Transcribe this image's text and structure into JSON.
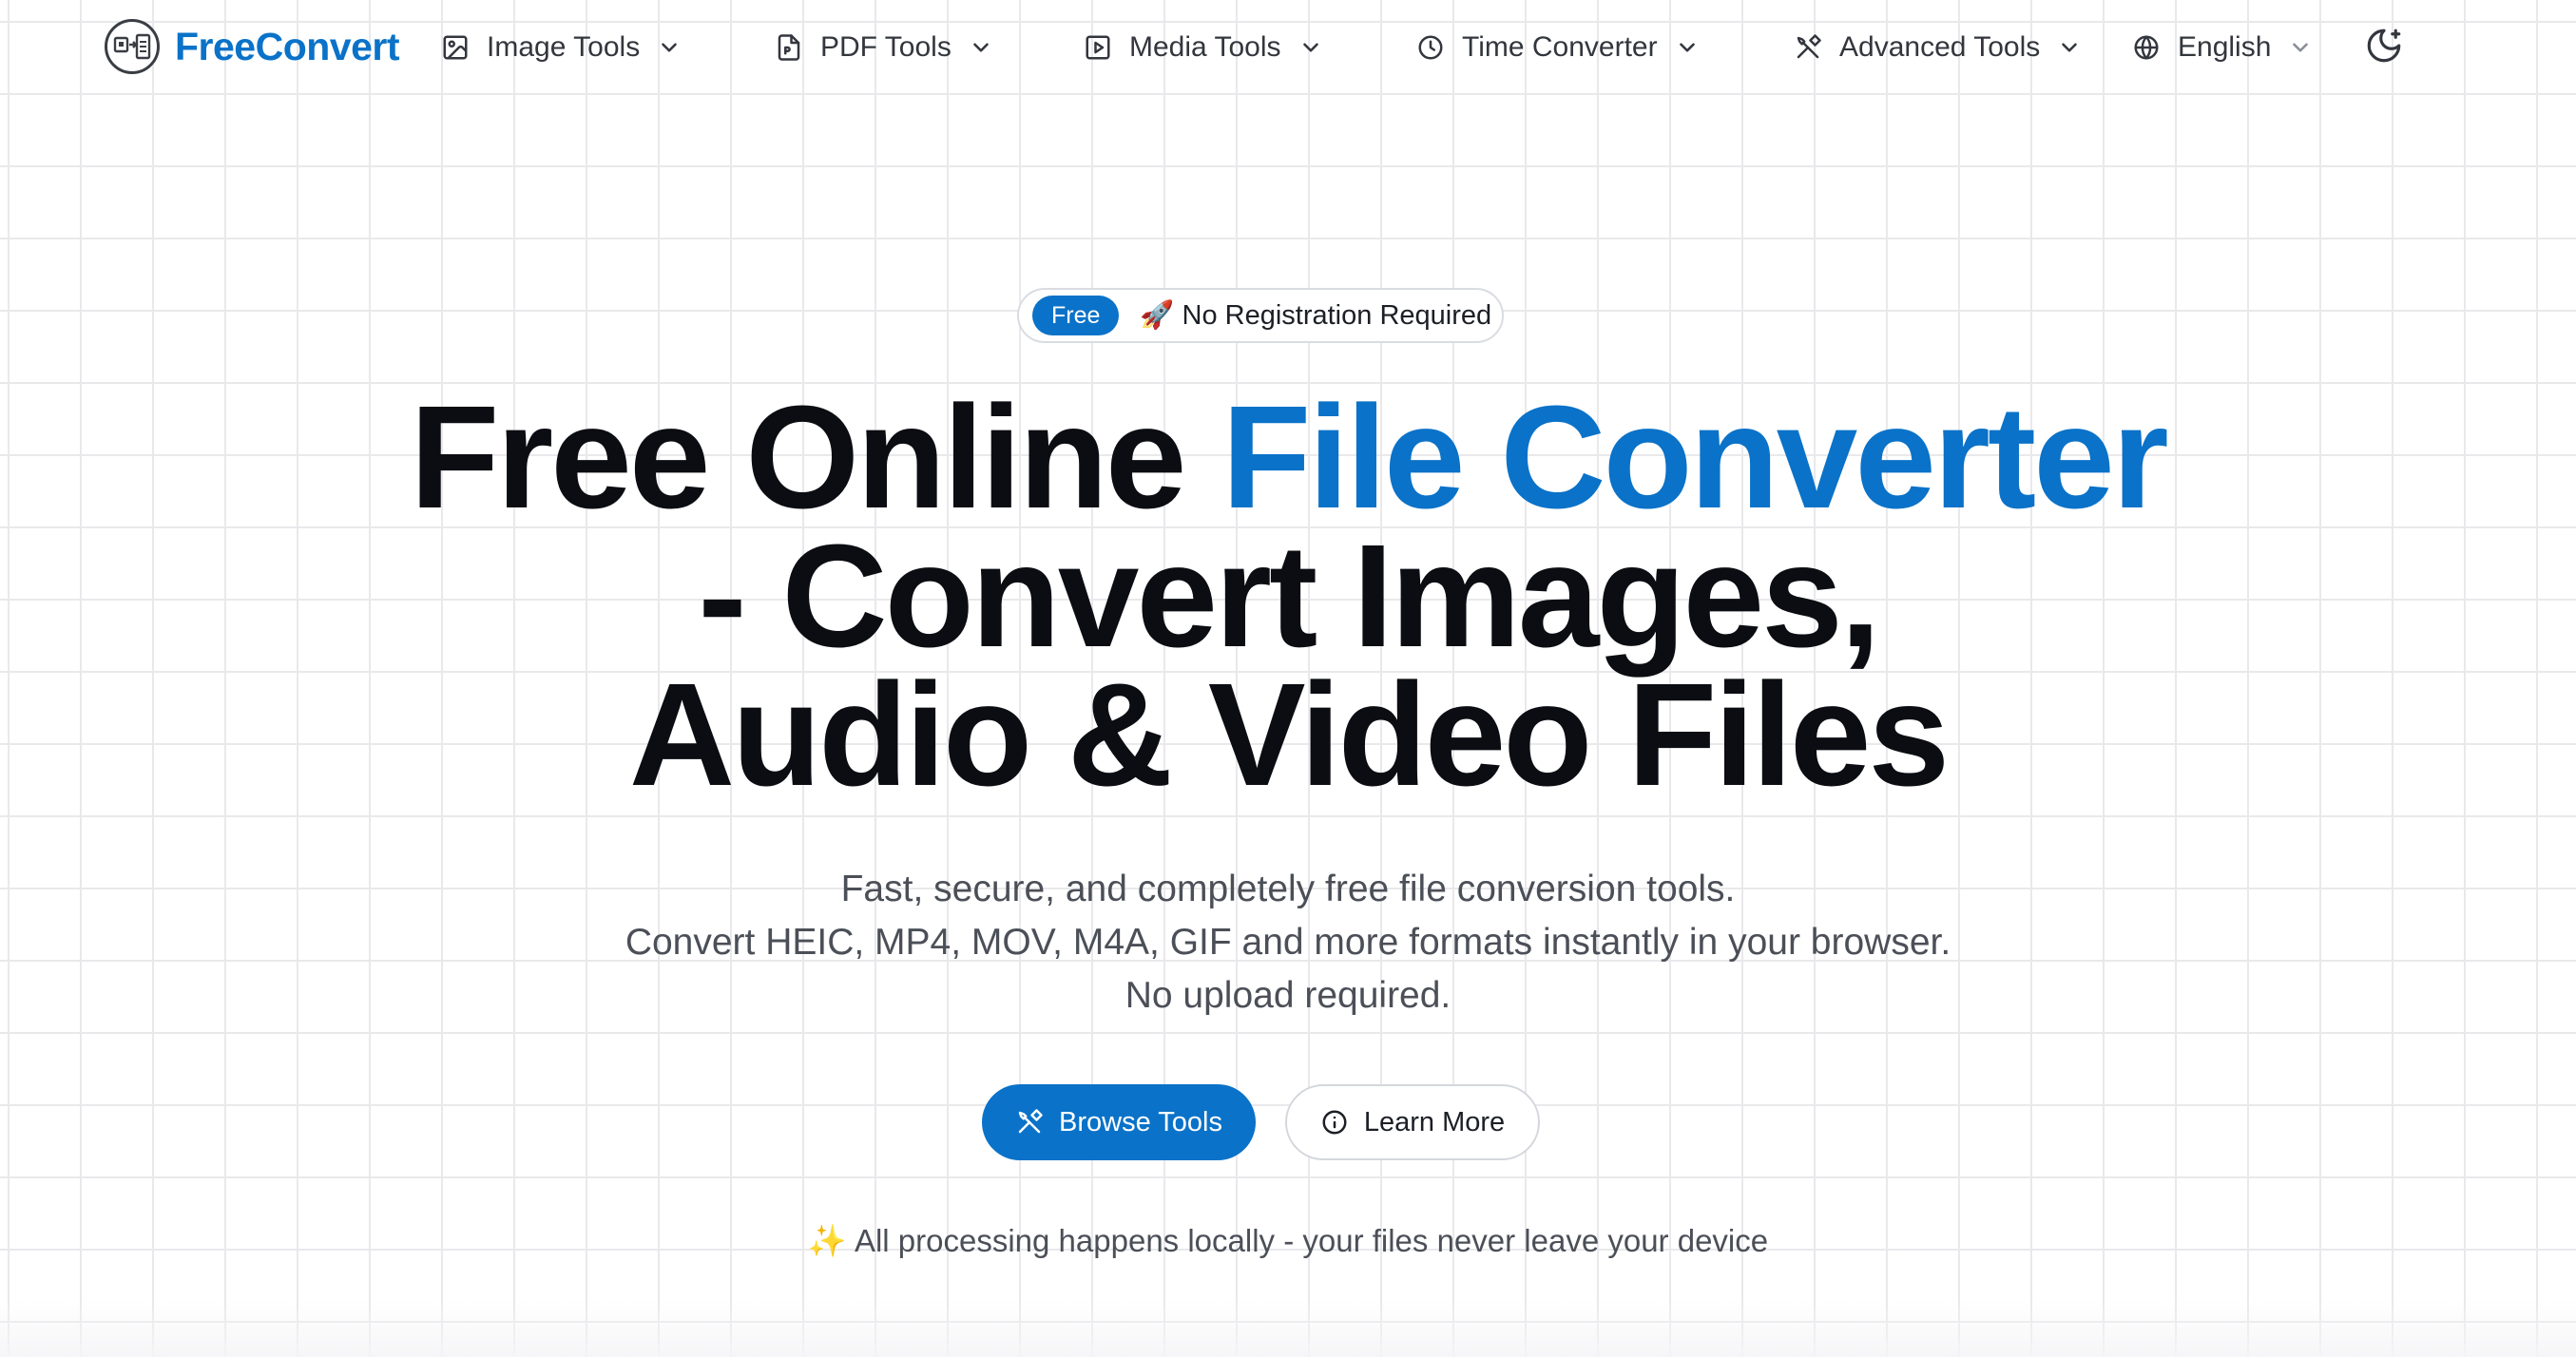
{
  "brand": {
    "name": "FreeConvert",
    "accent_color": "#0a72c8"
  },
  "nav": {
    "items": [
      {
        "label": "Image Tools",
        "icon": "image-icon"
      },
      {
        "label": "PDF Tools",
        "icon": "pdf-file-icon"
      },
      {
        "label": "Media Tools",
        "icon": "play-square-icon"
      },
      {
        "label": "Time Converter",
        "icon": "clock-icon"
      },
      {
        "label": "Advanced Tools",
        "icon": "tools-icon"
      }
    ],
    "language": {
      "label": "English",
      "icon": "globe-icon"
    },
    "theme_toggle_icon": "moon-sparkle-icon"
  },
  "hero": {
    "badge": {
      "pill": "Free",
      "emoji": "🚀",
      "text": "No Registration Required"
    },
    "headline": {
      "part1": "Free Online ",
      "accent": "File Converter",
      "line2": "- Convert Images,",
      "line3": "Audio & Video Files"
    },
    "subtitle": [
      "Fast, secure, and completely free file conversion tools.",
      "Convert HEIC, MP4, MOV, M4A, GIF and more formats instantly in your browser.",
      "No upload required."
    ],
    "buttons": {
      "primary": {
        "label": "Browse Tools",
        "icon": "tools-icon"
      },
      "secondary": {
        "label": "Learn More",
        "icon": "info-circle-icon"
      }
    },
    "footnote": {
      "emoji": "✨",
      "text": "All processing happens locally - your files never leave your device"
    }
  }
}
